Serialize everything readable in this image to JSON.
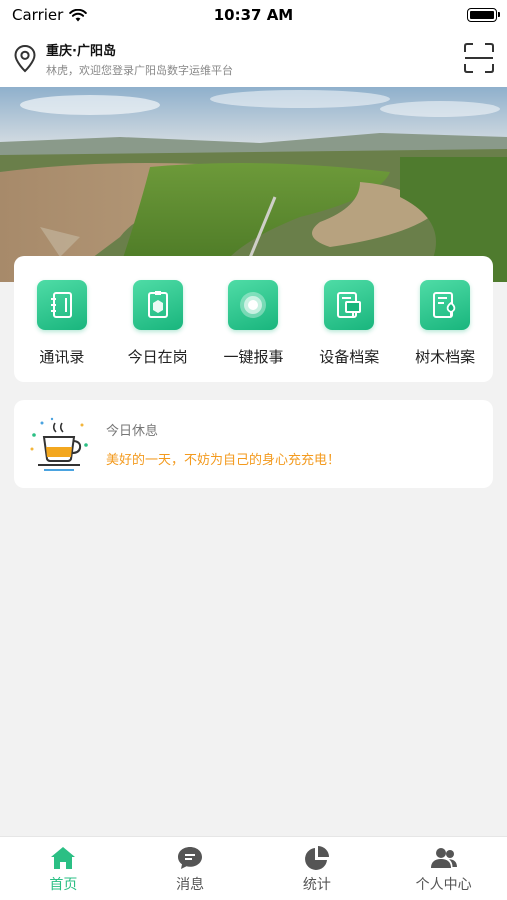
{
  "status_bar": {
    "carrier": "Carrier",
    "time": "10:37 AM"
  },
  "header": {
    "location": "重庆·广阳岛",
    "welcome": "林虎，欢迎您登录广阳岛数字运维平台",
    "icons": [
      "location-pin-icon",
      "scan-icon"
    ]
  },
  "quick_actions": [
    {
      "label": "通讯录",
      "icon": "contacts-book-icon"
    },
    {
      "label": "今日在岗",
      "icon": "on-duty-badge-icon"
    },
    {
      "label": "一键报事",
      "icon": "report-button-icon"
    },
    {
      "label": "设备档案",
      "icon": "device-file-icon"
    },
    {
      "label": "树木档案",
      "icon": "tree-file-icon"
    }
  ],
  "rest_card": {
    "title": "今日休息",
    "message": "美好的一天，不妨为自己的身心充充电！",
    "icon": "coffee-cup-icon"
  },
  "tab_bar": {
    "active": "首页",
    "tabs": [
      {
        "label": "首页",
        "icon": "home-icon"
      },
      {
        "label": "消息",
        "icon": "message-icon"
      },
      {
        "label": "统计",
        "icon": "pie-chart-icon"
      },
      {
        "label": "个人中心",
        "icon": "user-group-icon"
      }
    ]
  },
  "colors": {
    "accent": "#2bbf84",
    "warm_text": "#f39a1e",
    "background": "#f2f2f2"
  }
}
